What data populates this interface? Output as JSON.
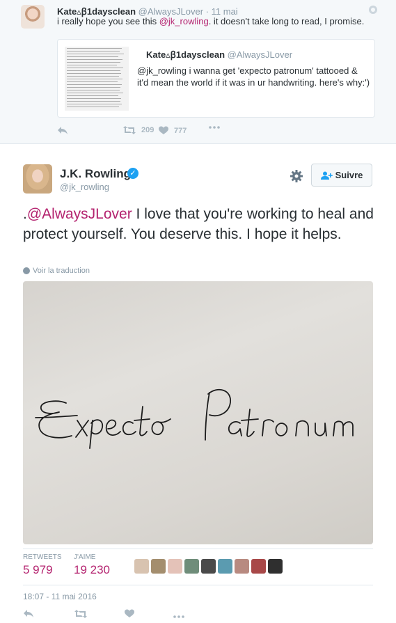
{
  "colors": {
    "link": "#b4236f",
    "muted": "#8899a6",
    "verified": "#1da1f2",
    "parent_background": "#f5f8fa"
  },
  "parent_tweet": {
    "display_name": "Kate▵ꞵ1daysclean",
    "handle": "@AlwaysJLover",
    "separator": "·",
    "date": "11 mai",
    "text_before": "i really hope you see this ",
    "mention": "@jk_rowling",
    "text_after": ". it doesn't take long to read, I promise.",
    "quoted": {
      "display_name": "Kate▵ꞵ1daysclean",
      "handle": "@AlwaysJLover",
      "text": "@jk_rowling i wanna get 'expecto patronum' tattooed & it'd mean the world if it was in ur handwriting. here's why:')"
    },
    "actions": {
      "reply_icon": "reply-icon",
      "retweet_icon": "retweet-icon",
      "retweet_count": "209",
      "like_icon": "heart-icon",
      "like_count": "777",
      "more_icon": "more-icon"
    }
  },
  "main_tweet": {
    "display_name": "J.K. Rowling",
    "handle": "@jk_rowling",
    "verified_icon": "verified-badge-icon",
    "follow_label": "Suivre",
    "text_prefix": ".",
    "mention": "@AlwaysJLover",
    "text": " I love that you're working to heal and protect yourself. You deserve this. I hope it helps.",
    "translate_label": "Voir la traduction",
    "photo_caption": "Expecto Patronum",
    "stats": {
      "retweets_label": "RETWEETS",
      "retweets_value": "5 979",
      "likes_label": "J'AIME",
      "likes_value": "19 230"
    },
    "liker_avatars": [
      "#d8c3b0",
      "#a48e6e",
      "#e4c2b8",
      "#6f8d7a",
      "#4a4a4a",
      "#5b9bb0",
      "#b88a80",
      "#a84848",
      "#2f2f2f"
    ],
    "timestamp": "18:07 - 11 mai 2016",
    "actions": {
      "reply_icon": "reply-icon",
      "retweet_icon": "retweet-icon",
      "like_icon": "heart-icon",
      "more_icon": "more-icon"
    }
  }
}
